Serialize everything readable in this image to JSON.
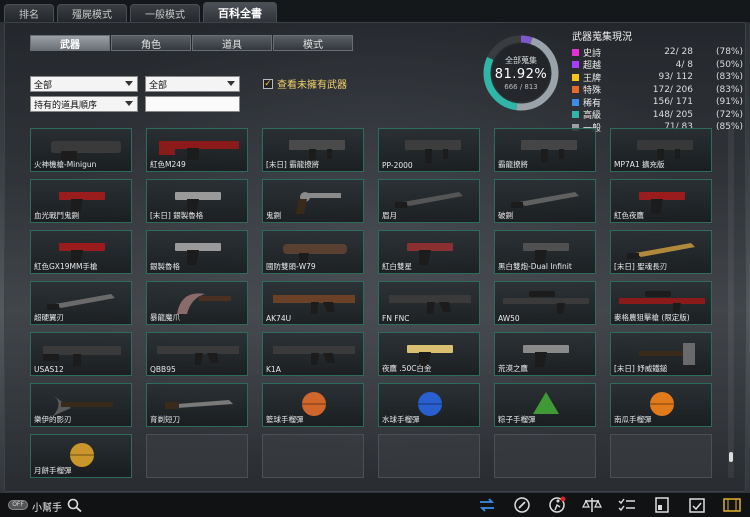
{
  "top_tabs": [
    "排名",
    "殭屍模式",
    "一般模式",
    "百科全書"
  ],
  "sub_tabs": [
    "武器",
    "角色",
    "道具",
    "模式"
  ],
  "filters": {
    "category1": "全部",
    "category2": "全部",
    "sort": "持有的道具順序",
    "search_value": "",
    "unowned_label": "查看未擁有武器",
    "unowned_checked": true
  },
  "collection": {
    "title": "全部蒐集",
    "percent": "81.92%",
    "count": "666 / 813",
    "fraction": 0.8192
  },
  "stats": {
    "title": "武器蒐集現況",
    "rows": [
      {
        "name": "史詩",
        "count": "22/  28",
        "pct": "(78%)",
        "color": "#e22fd6"
      },
      {
        "name": "超越",
        "count": "4/   8",
        "pct": "(50%)",
        "color": "#a63cff"
      },
      {
        "name": "王牌",
        "count": "93/ 112",
        "pct": "(83%)",
        "color": "#f5c518"
      },
      {
        "name": "特殊",
        "count": "172/ 206",
        "pct": "(83%)",
        "color": "#e86a2a"
      },
      {
        "name": "稀有",
        "count": "156/ 171",
        "pct": "(91%)",
        "color": "#3c8ce6"
      },
      {
        "name": "高級",
        "count": "148/ 205",
        "pct": "(72%)",
        "color": "#2fb6a8"
      },
      {
        "name": "一般",
        "count": "71/  83",
        "pct": "(85%)",
        "color": "#9aa0a6"
      }
    ]
  },
  "items": [
    {
      "name": "火神機槍-Minigun",
      "icon": "minigun-icon",
      "color": "#3a3a3a"
    },
    {
      "name": "紅色M249",
      "icon": "machine-gun-icon",
      "color": "#8b1a1a"
    },
    {
      "name": "[末日] 霸龍撩將",
      "icon": "smg-icon",
      "color": "#4a4a4a"
    },
    {
      "name": "PP-2000",
      "icon": "smg-icon",
      "color": "#3d3d3d"
    },
    {
      "name": "霸龍撩將",
      "icon": "smg-icon",
      "color": "#454545"
    },
    {
      "name": "MP7A1 擴充版",
      "icon": "smg-icon",
      "color": "#383838"
    },
    {
      "name": "血光戰鬥鬼鍘",
      "icon": "pistol-icon",
      "color": "#9a1c1c"
    },
    {
      "name": "[末日] 銀製魯格",
      "icon": "pistol-icon",
      "color": "#9a9a9a"
    },
    {
      "name": "鬼鍘",
      "icon": "revolver-icon",
      "color": "#8a8a8a"
    },
    {
      "name": "眉月",
      "icon": "blade-icon",
      "color": "#555555"
    },
    {
      "name": "破鍘",
      "icon": "blade-icon",
      "color": "#606060"
    },
    {
      "name": "紅色夜鷹",
      "icon": "pistol-icon",
      "color": "#9a1c1c"
    },
    {
      "name": "紅色GX19MM手槍",
      "icon": "pistol-icon",
      "color": "#9a1c1c"
    },
    {
      "name": "銀製魯格",
      "icon": "pistol-icon",
      "color": "#9a9a9a"
    },
    {
      "name": "國防雙頭-W79",
      "icon": "launcher-icon",
      "color": "#5a4030"
    },
    {
      "name": "紅白雙星",
      "icon": "pistol-icon",
      "color": "#8a3030"
    },
    {
      "name": "黑白雙炮-Dual Infinit",
      "icon": "pistol-icon",
      "color": "#505050"
    },
    {
      "name": "[末日] 聖魂長刃",
      "icon": "blade-icon",
      "color": "#b08a3a"
    },
    {
      "name": "超硬翼刃",
      "icon": "blade-icon",
      "color": "#6a6a6a"
    },
    {
      "name": "暴龍魔爪",
      "icon": "claw-icon",
      "color": "#8a6a6a"
    },
    {
      "name": "AK74U",
      "icon": "rifle-icon",
      "color": "#6a4026"
    },
    {
      "name": "FN FNC",
      "icon": "rifle-icon",
      "color": "#3a3a3a"
    },
    {
      "name": "AW50",
      "icon": "sniper-icon",
      "color": "#3a3a3a"
    },
    {
      "name": "麥格農狙擊槍 (限定版)",
      "icon": "sniper-icon",
      "color": "#8b1a1a"
    },
    {
      "name": "USAS12",
      "icon": "shotgun-icon",
      "color": "#3a3a3a"
    },
    {
      "name": "QBB95",
      "icon": "rifle-icon",
      "color": "#3a3a3a"
    },
    {
      "name": "K1A",
      "icon": "rifle-icon",
      "color": "#3a3a3a"
    },
    {
      "name": "夜鷹 .50C白金",
      "icon": "pistol-icon",
      "color": "#d8c070"
    },
    {
      "name": "荒漠之鷹",
      "icon": "pistol-icon",
      "color": "#8a8a8a"
    },
    {
      "name": "[末日] 妤威鐵鎚",
      "icon": "hammer-icon",
      "color": "#6a6a6a"
    },
    {
      "name": "樂伊的影刃",
      "icon": "axe-icon",
      "color": "#5a5a5a"
    },
    {
      "name": "育剃短刀",
      "icon": "knife-icon",
      "color": "#7a7a7a"
    },
    {
      "name": "籃球手榴彈",
      "icon": "basketball-grenade-icon",
      "color": "#d0662a"
    },
    {
      "name": "水球手榴彈",
      "icon": "water-balloon-icon",
      "color": "#2a5fd0"
    },
    {
      "name": "粽子手榴彈",
      "icon": "zongzi-grenade-icon",
      "color": "#3f9a35"
    },
    {
      "name": "南瓜手榴彈",
      "icon": "pumpkin-grenade-icon",
      "color": "#e07a1a"
    },
    {
      "name": "月餅手榴彈",
      "icon": "mooncake-grenade-icon",
      "color": "#c8962a"
    },
    {
      "name": "",
      "icon": "",
      "color": ""
    },
    {
      "name": "",
      "icon": "",
      "color": ""
    },
    {
      "name": "",
      "icon": "",
      "color": ""
    },
    {
      "name": "",
      "icon": "",
      "color": ""
    },
    {
      "name": "",
      "icon": "",
      "color": ""
    }
  ],
  "bottom": {
    "help_toggle": "OFF",
    "help_label": "小幫手",
    "tools": [
      "swap-icon",
      "compass-icon",
      "runner-icon",
      "scale-icon",
      "checklist-icon",
      "card-icon",
      "calendar-icon",
      "film-icon"
    ]
  }
}
